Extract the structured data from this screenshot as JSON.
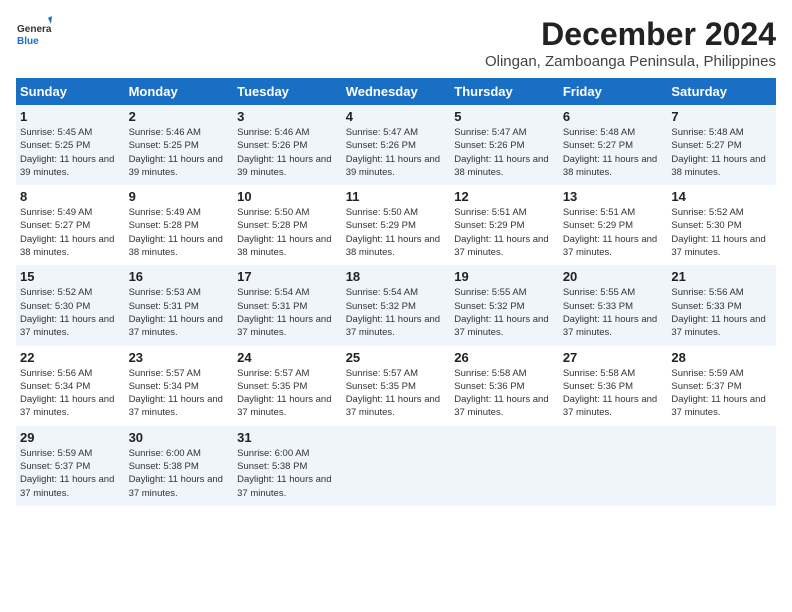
{
  "header": {
    "logo_general": "General",
    "logo_blue": "Blue",
    "month_title": "December 2024",
    "location": "Olingan, Zamboanga Peninsula, Philippines"
  },
  "days_of_week": [
    "Sunday",
    "Monday",
    "Tuesday",
    "Wednesday",
    "Thursday",
    "Friday",
    "Saturday"
  ],
  "weeks": [
    [
      {
        "day": "1",
        "sunrise": "5:45 AM",
        "sunset": "5:25 PM",
        "daylight": "11 hours and 39 minutes."
      },
      {
        "day": "2",
        "sunrise": "5:46 AM",
        "sunset": "5:25 PM",
        "daylight": "11 hours and 39 minutes."
      },
      {
        "day": "3",
        "sunrise": "5:46 AM",
        "sunset": "5:26 PM",
        "daylight": "11 hours and 39 minutes."
      },
      {
        "day": "4",
        "sunrise": "5:47 AM",
        "sunset": "5:26 PM",
        "daylight": "11 hours and 39 minutes."
      },
      {
        "day": "5",
        "sunrise": "5:47 AM",
        "sunset": "5:26 PM",
        "daylight": "11 hours and 38 minutes."
      },
      {
        "day": "6",
        "sunrise": "5:48 AM",
        "sunset": "5:27 PM",
        "daylight": "11 hours and 38 minutes."
      },
      {
        "day": "7",
        "sunrise": "5:48 AM",
        "sunset": "5:27 PM",
        "daylight": "11 hours and 38 minutes."
      }
    ],
    [
      {
        "day": "8",
        "sunrise": "5:49 AM",
        "sunset": "5:27 PM",
        "daylight": "11 hours and 38 minutes."
      },
      {
        "day": "9",
        "sunrise": "5:49 AM",
        "sunset": "5:28 PM",
        "daylight": "11 hours and 38 minutes."
      },
      {
        "day": "10",
        "sunrise": "5:50 AM",
        "sunset": "5:28 PM",
        "daylight": "11 hours and 38 minutes."
      },
      {
        "day": "11",
        "sunrise": "5:50 AM",
        "sunset": "5:29 PM",
        "daylight": "11 hours and 38 minutes."
      },
      {
        "day": "12",
        "sunrise": "5:51 AM",
        "sunset": "5:29 PM",
        "daylight": "11 hours and 37 minutes."
      },
      {
        "day": "13",
        "sunrise": "5:51 AM",
        "sunset": "5:29 PM",
        "daylight": "11 hours and 37 minutes."
      },
      {
        "day": "14",
        "sunrise": "5:52 AM",
        "sunset": "5:30 PM",
        "daylight": "11 hours and 37 minutes."
      }
    ],
    [
      {
        "day": "15",
        "sunrise": "5:52 AM",
        "sunset": "5:30 PM",
        "daylight": "11 hours and 37 minutes."
      },
      {
        "day": "16",
        "sunrise": "5:53 AM",
        "sunset": "5:31 PM",
        "daylight": "11 hours and 37 minutes."
      },
      {
        "day": "17",
        "sunrise": "5:54 AM",
        "sunset": "5:31 PM",
        "daylight": "11 hours and 37 minutes."
      },
      {
        "day": "18",
        "sunrise": "5:54 AM",
        "sunset": "5:32 PM",
        "daylight": "11 hours and 37 minutes."
      },
      {
        "day": "19",
        "sunrise": "5:55 AM",
        "sunset": "5:32 PM",
        "daylight": "11 hours and 37 minutes."
      },
      {
        "day": "20",
        "sunrise": "5:55 AM",
        "sunset": "5:33 PM",
        "daylight": "11 hours and 37 minutes."
      },
      {
        "day": "21",
        "sunrise": "5:56 AM",
        "sunset": "5:33 PM",
        "daylight": "11 hours and 37 minutes."
      }
    ],
    [
      {
        "day": "22",
        "sunrise": "5:56 AM",
        "sunset": "5:34 PM",
        "daylight": "11 hours and 37 minutes."
      },
      {
        "day": "23",
        "sunrise": "5:57 AM",
        "sunset": "5:34 PM",
        "daylight": "11 hours and 37 minutes."
      },
      {
        "day": "24",
        "sunrise": "5:57 AM",
        "sunset": "5:35 PM",
        "daylight": "11 hours and 37 minutes."
      },
      {
        "day": "25",
        "sunrise": "5:57 AM",
        "sunset": "5:35 PM",
        "daylight": "11 hours and 37 minutes."
      },
      {
        "day": "26",
        "sunrise": "5:58 AM",
        "sunset": "5:36 PM",
        "daylight": "11 hours and 37 minutes."
      },
      {
        "day": "27",
        "sunrise": "5:58 AM",
        "sunset": "5:36 PM",
        "daylight": "11 hours and 37 minutes."
      },
      {
        "day": "28",
        "sunrise": "5:59 AM",
        "sunset": "5:37 PM",
        "daylight": "11 hours and 37 minutes."
      }
    ],
    [
      {
        "day": "29",
        "sunrise": "5:59 AM",
        "sunset": "5:37 PM",
        "daylight": "11 hours and 37 minutes."
      },
      {
        "day": "30",
        "sunrise": "6:00 AM",
        "sunset": "5:38 PM",
        "daylight": "11 hours and 37 minutes."
      },
      {
        "day": "31",
        "sunrise": "6:00 AM",
        "sunset": "5:38 PM",
        "daylight": "11 hours and 37 minutes."
      },
      null,
      null,
      null,
      null
    ]
  ]
}
